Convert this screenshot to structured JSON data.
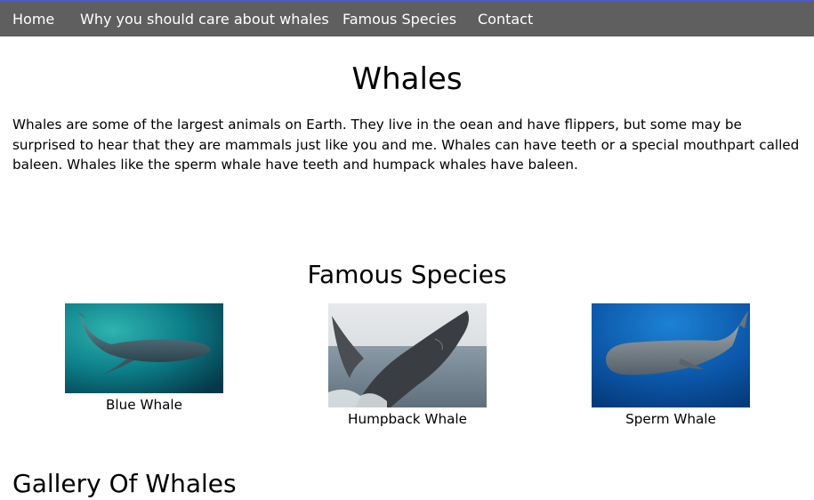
{
  "nav": {
    "items": [
      {
        "label": "Home"
      },
      {
        "label": "Why you should care about whales"
      },
      {
        "label": "Famous Species"
      },
      {
        "label": "Contact"
      }
    ]
  },
  "main": {
    "title": "Whales",
    "intro": "Whales are some of the largest animals on Earth. They live in the oean and have flippers, but some may be surprised to hear that they are mammals just like you and me. Whales can have teeth or a special mouthpart called baleen. Whales like the sperm whale have teeth and humpack whales have baleen."
  },
  "species": {
    "title": "Famous Species",
    "items": [
      {
        "name": "Blue Whale"
      },
      {
        "name": "Humpback Whale"
      },
      {
        "name": "Sperm Whale"
      }
    ]
  },
  "gallery": {
    "title": "Gallery Of Whales"
  }
}
